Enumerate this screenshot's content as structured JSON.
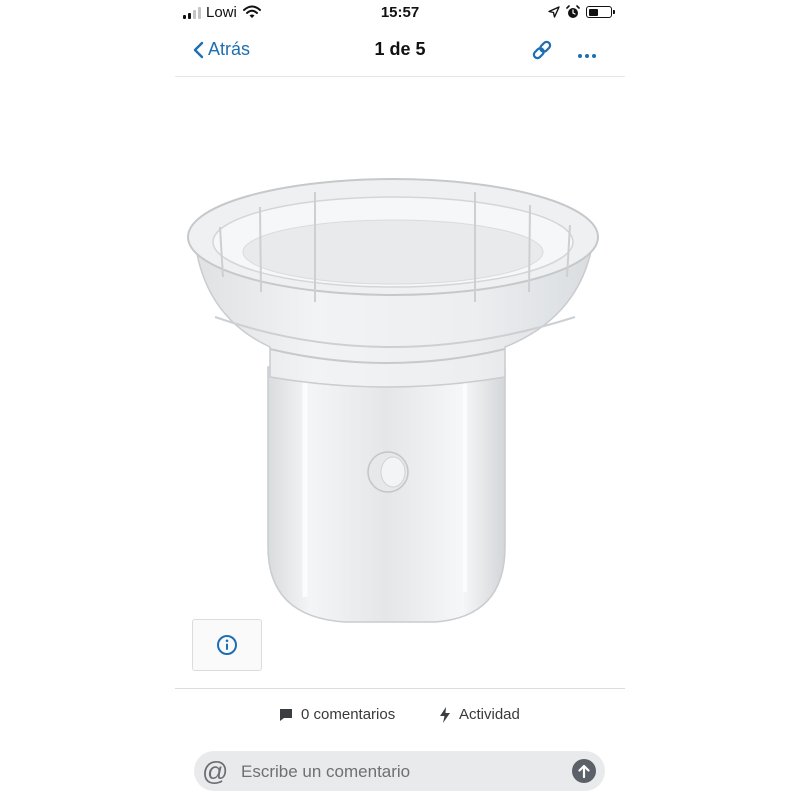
{
  "status_bar": {
    "carrier": "Lowi",
    "time": "15:57",
    "battery_level": 0.45
  },
  "nav": {
    "back_label": "Atrás",
    "title": "1 de 5"
  },
  "footer": {
    "comments_label": "0 comentarios",
    "activity_label": "Actividad",
    "comment_placeholder": "Escribe un comentario"
  },
  "colors": {
    "accent": "#1c6fb3",
    "text": "#111111",
    "secondary_text": "#3a3a3a",
    "input_bg": "#e9eaec"
  },
  "icons": {
    "back": "chevron-left-icon",
    "link": "link-icon",
    "more": "more-dots-icon",
    "info": "info-icon",
    "comments": "comment-bubble-icon",
    "activity": "lightning-bolt-icon",
    "mention": "at-sign-icon",
    "send": "arrow-up-icon"
  }
}
